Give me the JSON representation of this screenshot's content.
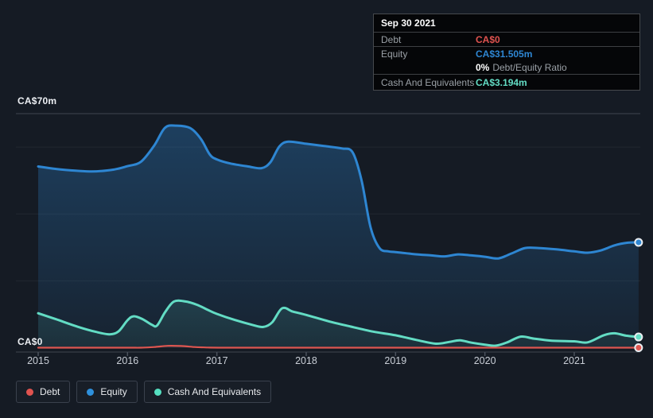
{
  "y_axis": {
    "top_label": "CA$70m",
    "zero_label": "CA$0"
  },
  "x_axis": {
    "years": [
      "2015",
      "2016",
      "2017",
      "2018",
      "2019",
      "2020",
      "2021"
    ]
  },
  "tooltip": {
    "date": "Sep 30 2021",
    "debt_label": "Debt",
    "debt_value": "CA$0",
    "equity_label": "Equity",
    "equity_value": "CA$31.505m",
    "ratio_value": "0%",
    "ratio_text": "Debt/Equity Ratio",
    "cash_label": "Cash And Equivalents",
    "cash_value": "CA$3.194m"
  },
  "legend": {
    "items": [
      {
        "id": "debt",
        "label": "Debt",
        "color": "#e0534f"
      },
      {
        "id": "equity",
        "label": "Equity",
        "color": "#2e90dc"
      },
      {
        "id": "cash",
        "label": "Cash And Equivalents",
        "color": "#55dfc0"
      }
    ]
  },
  "colors": {
    "background": "#151b24",
    "gridline_minor": "rgba(255,255,255,0.06)",
    "gridline_major": "#3e4651",
    "axis_tick": "#4a515c",
    "debt": "#e0534f",
    "equity": "#2e86d2",
    "cash": "#63dcc4"
  },
  "chart_data": {
    "type": "area",
    "unit": "CA$ millions",
    "x_range": [
      2015.0,
      2021.75
    ],
    "x_ticks": [
      2015,
      2016,
      2017,
      2018,
      2019,
      2020,
      2021
    ],
    "y_min": 0,
    "y_max": 70,
    "y_top_label": "CA$70m",
    "y_zero_label": "CA$0",
    "gridline_values": [
      20,
      40,
      60
    ],
    "grid": true,
    "legend_position": "bottom-left",
    "tooltip_date": "Sep 30 2021",
    "series": [
      {
        "name": "Equity",
        "color": "#2e86d2",
        "end_value": 31.505,
        "end_value_label": "CA$31.505m",
        "points": [
          [
            2015.0,
            54.2
          ],
          [
            2015.25,
            53.3
          ],
          [
            2015.6,
            52.7
          ],
          [
            2015.85,
            53.3
          ],
          [
            2016.0,
            54.3
          ],
          [
            2016.15,
            55.6
          ],
          [
            2016.3,
            60.5
          ],
          [
            2016.42,
            65.8
          ],
          [
            2016.55,
            66.4
          ],
          [
            2016.7,
            65.7
          ],
          [
            2016.82,
            62.5
          ],
          [
            2016.92,
            57.8
          ],
          [
            2017.0,
            56.3
          ],
          [
            2017.15,
            55.1
          ],
          [
            2017.35,
            54.2
          ],
          [
            2017.5,
            53.7
          ],
          [
            2017.6,
            55.5
          ],
          [
            2017.7,
            60.2
          ],
          [
            2017.8,
            61.6
          ],
          [
            2018.0,
            61.0
          ],
          [
            2018.2,
            60.3
          ],
          [
            2018.4,
            59.6
          ],
          [
            2018.52,
            58.4
          ],
          [
            2018.62,
            50.0
          ],
          [
            2018.72,
            36.0
          ],
          [
            2018.82,
            29.8
          ],
          [
            2018.92,
            28.8
          ],
          [
            2019.0,
            28.6
          ],
          [
            2019.2,
            28.0
          ],
          [
            2019.4,
            27.6
          ],
          [
            2019.55,
            27.3
          ],
          [
            2019.7,
            27.9
          ],
          [
            2019.85,
            27.6
          ],
          [
            2020.0,
            27.2
          ],
          [
            2020.15,
            26.7
          ],
          [
            2020.3,
            28.2
          ],
          [
            2020.45,
            29.8
          ],
          [
            2020.6,
            29.8
          ],
          [
            2020.8,
            29.4
          ],
          [
            2021.0,
            28.8
          ],
          [
            2021.15,
            28.4
          ],
          [
            2021.3,
            29.1
          ],
          [
            2021.45,
            30.6
          ],
          [
            2021.6,
            31.4
          ],
          [
            2021.72,
            31.505
          ]
        ]
      },
      {
        "name": "Cash And Equivalents",
        "color": "#63dcc4",
        "end_value": 3.194,
        "end_value_label": "CA$3.194m",
        "points": [
          [
            2015.0,
            10.3
          ],
          [
            2015.2,
            8.5
          ],
          [
            2015.45,
            6.2
          ],
          [
            2015.65,
            4.7
          ],
          [
            2015.8,
            4.0
          ],
          [
            2015.9,
            4.9
          ],
          [
            2016.0,
            8.2
          ],
          [
            2016.07,
            9.4
          ],
          [
            2016.17,
            8.5
          ],
          [
            2016.27,
            6.9
          ],
          [
            2016.33,
            6.6
          ],
          [
            2016.42,
            10.6
          ],
          [
            2016.52,
            13.8
          ],
          [
            2016.65,
            13.8
          ],
          [
            2016.78,
            12.8
          ],
          [
            2016.9,
            11.3
          ],
          [
            2017.0,
            10.1
          ],
          [
            2017.2,
            8.3
          ],
          [
            2017.4,
            6.8
          ],
          [
            2017.52,
            6.2
          ],
          [
            2017.62,
            7.6
          ],
          [
            2017.73,
            11.8
          ],
          [
            2017.85,
            10.8
          ],
          [
            2018.0,
            9.8
          ],
          [
            2018.25,
            7.9
          ],
          [
            2018.5,
            6.3
          ],
          [
            2018.75,
            4.8
          ],
          [
            2019.0,
            3.7
          ],
          [
            2019.25,
            2.2
          ],
          [
            2019.45,
            1.2
          ],
          [
            2019.6,
            1.7
          ],
          [
            2019.72,
            2.2
          ],
          [
            2019.85,
            1.5
          ],
          [
            2020.0,
            0.9
          ],
          [
            2020.12,
            0.6
          ],
          [
            2020.25,
            1.6
          ],
          [
            2020.4,
            3.3
          ],
          [
            2020.55,
            2.7
          ],
          [
            2020.75,
            2.1
          ],
          [
            2021.0,
            1.9
          ],
          [
            2021.15,
            1.6
          ],
          [
            2021.33,
            3.7
          ],
          [
            2021.45,
            4.3
          ],
          [
            2021.58,
            3.6
          ],
          [
            2021.72,
            3.194
          ]
        ]
      },
      {
        "name": "Debt",
        "color": "#de5650",
        "end_value": 0,
        "end_value_label": "CA$0",
        "points": [
          [
            2015.0,
            0
          ],
          [
            2015.5,
            0
          ],
          [
            2016.0,
            0
          ],
          [
            2016.15,
            0
          ],
          [
            2016.3,
            0.2
          ],
          [
            2016.45,
            0.55
          ],
          [
            2016.6,
            0.5
          ],
          [
            2016.75,
            0.2
          ],
          [
            2016.9,
            0.05
          ],
          [
            2017.1,
            0
          ],
          [
            2017.5,
            0
          ],
          [
            2018.0,
            0
          ],
          [
            2018.5,
            0
          ],
          [
            2019.0,
            0
          ],
          [
            2019.5,
            0
          ],
          [
            2020.0,
            0
          ],
          [
            2020.5,
            0
          ],
          [
            2021.0,
            0
          ],
          [
            2021.4,
            0
          ],
          [
            2021.72,
            0
          ]
        ]
      }
    ]
  }
}
